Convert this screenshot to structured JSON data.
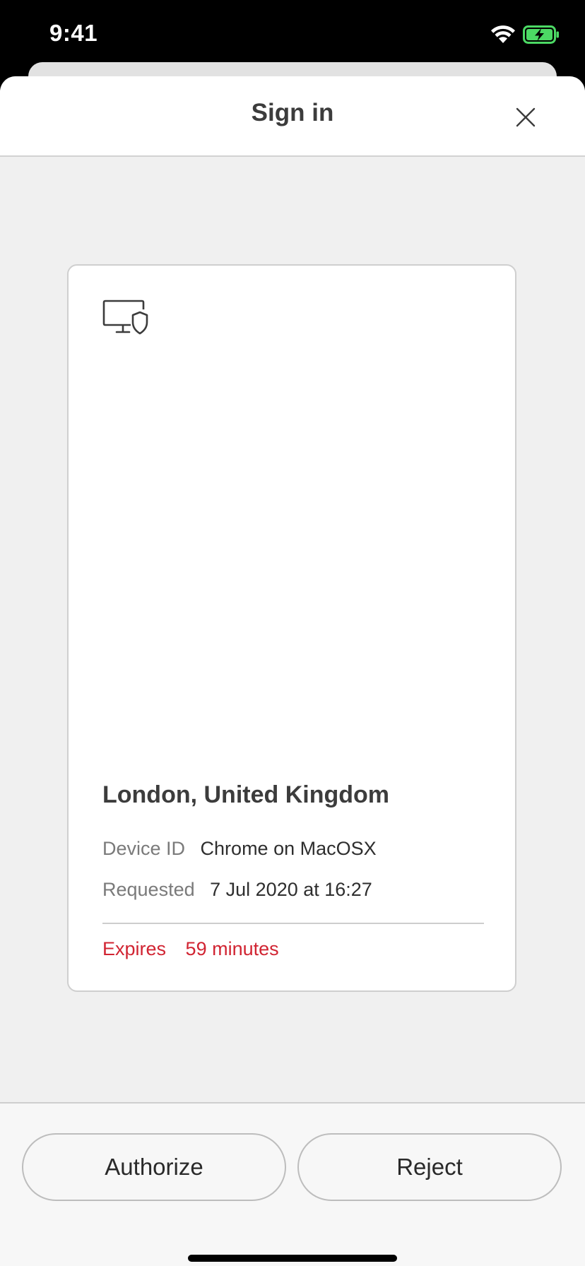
{
  "status_bar": {
    "time": "9:41",
    "wifi_icon": "wifi-icon",
    "battery_icon": "battery-charging-icon",
    "battery_color": "#4cd964"
  },
  "sheet": {
    "title": "Sign in",
    "close_icon": "close-icon"
  },
  "request": {
    "icon": "monitor-shield-icon",
    "location": "London, United Kingdom",
    "device_label": "Device ID",
    "device_value": "Chrome on MacOSX",
    "requested_label": "Requested",
    "requested_value": "7 Jul 2020 at 16:27",
    "expires_label": "Expires",
    "expires_value": "59 minutes",
    "expires_color": "#d12432"
  },
  "actions": {
    "authorize_label": "Authorize",
    "reject_label": "Reject"
  }
}
